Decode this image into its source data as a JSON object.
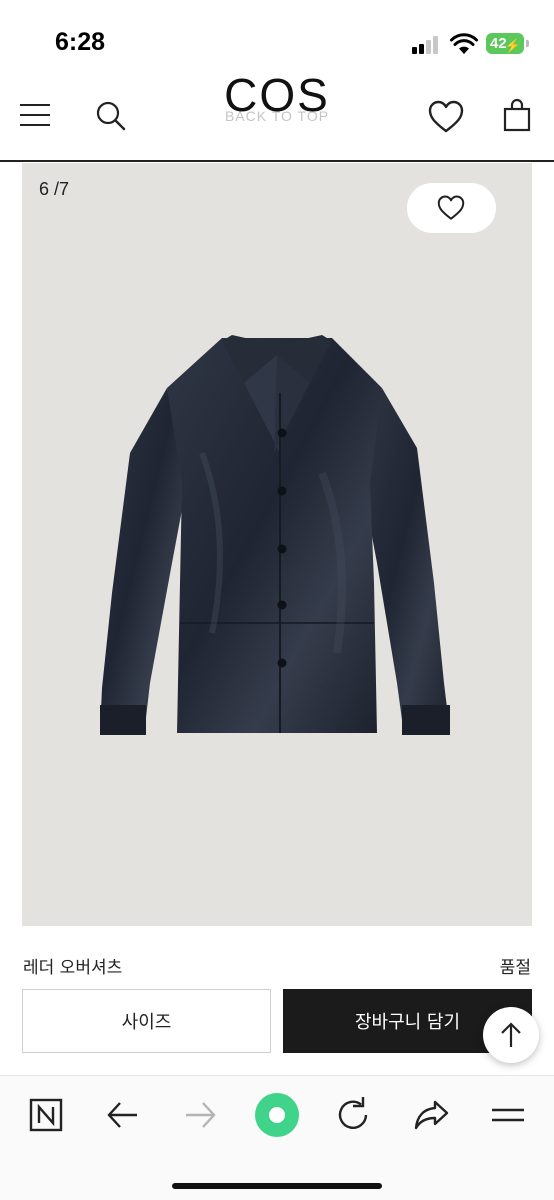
{
  "status_bar": {
    "time": "6:28",
    "battery": "42"
  },
  "header": {
    "logo": "COS",
    "back_to_top": "BACK TO TOP",
    "icons": [
      "menu-icon",
      "search-icon",
      "heart-icon",
      "shopping-bag-icon"
    ]
  },
  "gallery": {
    "counter": "6 /7",
    "wishlist_icon": "heart-icon",
    "background": "#e4e2df"
  },
  "product": {
    "name": "레더 오버셔츠",
    "status": "품절"
  },
  "actions": {
    "size_label": "사이즈",
    "cart_label": "장바구니 담기",
    "cart_color": "#1b1b1b"
  },
  "browser_toolbar": {
    "icons": [
      "naver-n-icon",
      "back-arrow-icon",
      "forward-arrow-icon",
      "green-dot-icon",
      "reload-icon",
      "share-icon",
      "menu-icon"
    ],
    "accent": "#3fd48a"
  }
}
